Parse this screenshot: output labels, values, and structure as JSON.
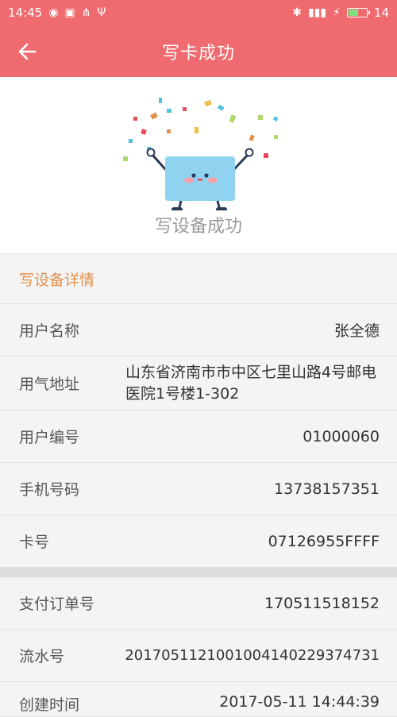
{
  "status_bar": {
    "time": "14:45",
    "battery": "14"
  },
  "header": {
    "title": "写卡成功"
  },
  "hero": {
    "message": "写设备成功"
  },
  "section": {
    "title": "写设备详情"
  },
  "rows": [
    {
      "label": "用户名称",
      "value": "张全德"
    },
    {
      "label": "用气地址",
      "value": "山东省济南市市中区七里山路4号邮电医院1号楼1-302"
    },
    {
      "label": "用户编号",
      "value": "01000060"
    },
    {
      "label": "手机号码",
      "value": "13738157351"
    },
    {
      "label": "卡号",
      "value": "07126955FFFF"
    }
  ],
  "rows2": [
    {
      "label": "支付订单号",
      "value": "170511518152"
    },
    {
      "label": "流水号",
      "value": "20170511210010041402293747​31"
    },
    {
      "label": "创建时间",
      "value": "2017-05-11 14:44:39"
    }
  ],
  "colors": {
    "brand": "#ef6b6f",
    "accent": "#e2924a"
  }
}
